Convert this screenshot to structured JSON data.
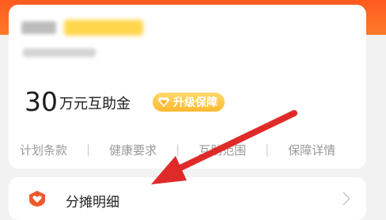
{
  "card": {
    "amount_value": "30",
    "amount_unit": "万元互助金",
    "upgrade_label": "升级保障",
    "links": [
      "计划条款",
      "健康要求",
      "互助范围",
      "保障详情"
    ],
    "separator": "|"
  },
  "detail_row": {
    "label": "分摊明细"
  },
  "colors": {
    "accent": "#ff5a1f",
    "badge": "#ffb92e",
    "arrow": "#e02a2a",
    "icon": "#f05a2a"
  },
  "icons": [
    "shield-heart-icon",
    "chevron-right-icon",
    "diamond-icon"
  ]
}
